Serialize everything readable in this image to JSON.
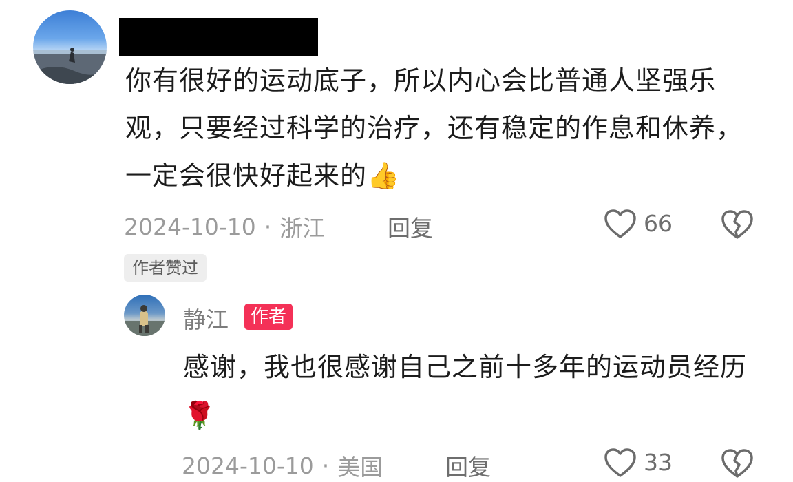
{
  "comment": {
    "text": "你有很好的运动底子，所以内心会比普通人坚强乐观，只要经过科学的治疗，还有稳定的作息和休养，一定会很快好起来的",
    "emoji": "👍",
    "date": "2024-10-10",
    "separator": "·",
    "location": "浙江",
    "reply_label": "回复",
    "like_count": "66",
    "liked_by_author_label": "作者赞过"
  },
  "reply": {
    "username": "静江",
    "author_badge": "作者",
    "text": "感谢，我也很感谢自己之前十多年的运动员经历",
    "emoji": "🌹",
    "date": "2024-10-10",
    "separator": "·",
    "location": "美国",
    "reply_label": "回复",
    "like_count": "33"
  },
  "icons": {
    "like": "heart-outline-icon",
    "dislike": "broken-heart-icon"
  }
}
